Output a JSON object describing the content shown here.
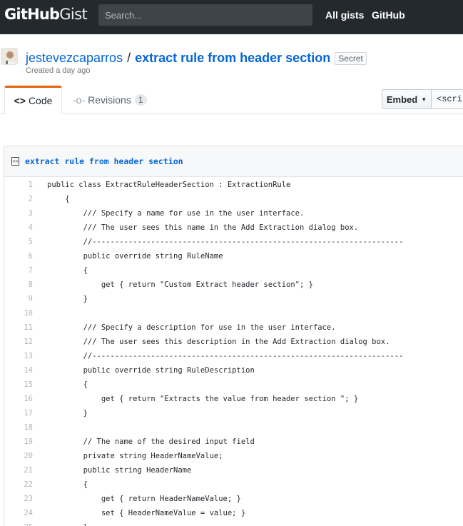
{
  "header": {
    "logo_bold": "GitHub",
    "logo_light": "Gist",
    "search_placeholder": "Search...",
    "nav": [
      "All gists",
      "GitHub"
    ]
  },
  "gist": {
    "owner": "jestevezcaparros",
    "separator": "/",
    "name": "extract rule from header section",
    "visibility": "Secret",
    "created": "Created a day ago"
  },
  "tabs": {
    "code_label": "Code",
    "revisions_label": "Revisions",
    "revisions_count": "1"
  },
  "embed": {
    "button_label": "Embed",
    "input_value": "<script"
  },
  "file": {
    "name": "extract rule from header section",
    "lines": [
      "public class ExtractRuleHeaderSection : ExtractionRule",
      "    {",
      "        /// Specify a name for use in the user interface.",
      "        /// The user sees this name in the Add Extraction dialog box.",
      "        //---------------------------------------------------------------------",
      "        public override string RuleName",
      "        {",
      "            get { return \"Custom Extract header section\"; }",
      "        }",
      "",
      "        /// Specify a description for use in the user interface.",
      "        /// The user sees this description in the Add Extraction dialog box.",
      "        //---------------------------------------------------------------------",
      "        public override string RuleDescription",
      "        {",
      "            get { return \"Extracts the value from header section \"; }",
      "        }",
      "",
      "        // The name of the desired input field",
      "        private string HeaderNameValue;",
      "        public string HeaderName",
      "        {",
      "            get { return HeaderNameValue; }",
      "            set { HeaderNameValue = value; }",
      "        }"
    ]
  }
}
